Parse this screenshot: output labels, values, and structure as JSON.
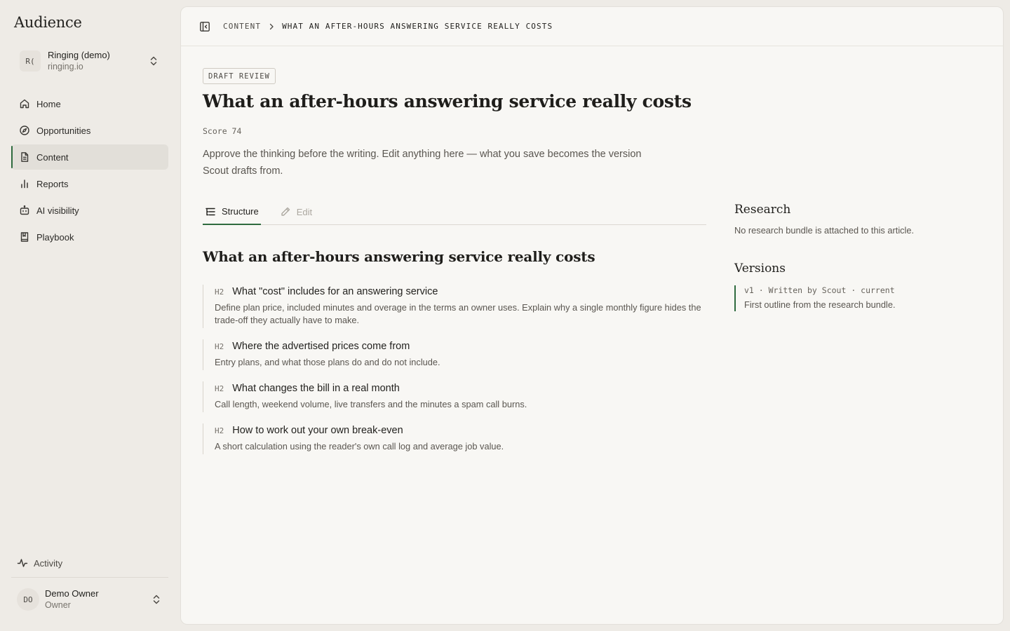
{
  "app": {
    "title": "Audience"
  },
  "workspace": {
    "avatar": "R(",
    "name": "Ringing (demo)",
    "domain": "ringing.io"
  },
  "nav": [
    {
      "label": "Home",
      "icon": "home-icon"
    },
    {
      "label": "Opportunities",
      "icon": "compass-icon"
    },
    {
      "label": "Content",
      "icon": "document-icon",
      "active": true
    },
    {
      "label": "Reports",
      "icon": "bar-chart-icon"
    },
    {
      "label": "AI visibility",
      "icon": "robot-icon"
    },
    {
      "label": "Playbook",
      "icon": "book-icon"
    }
  ],
  "activity": {
    "label": "Activity"
  },
  "user": {
    "initials": "DO",
    "name": "Demo Owner",
    "role": "Owner"
  },
  "breadcrumb": [
    "CONTENT",
    "WHAT AN AFTER-HOURS ANSWERING SERVICE REALLY COSTS"
  ],
  "article": {
    "badge": "DRAFT REVIEW",
    "title": "What an after-hours answering service really costs",
    "score": "Score 74",
    "intro": "Approve the thinking before the writing. Edit anything here — what you save becomes the version Scout drafts from."
  },
  "tabs": [
    {
      "label": "Structure",
      "icon": "list-tree-icon",
      "active": true
    },
    {
      "label": "Edit",
      "icon": "pencil-icon",
      "active": false
    }
  ],
  "outline": {
    "title": "What an after-hours answering service really costs",
    "sections": [
      {
        "level": "H2",
        "heading": "What \"cost\" includes for an answering service",
        "description": "Define plan price, included minutes and overage in the terms an owner uses. Explain why a single monthly figure hides the trade-off they actually have to make."
      },
      {
        "level": "H2",
        "heading": "Where the advertised prices come from",
        "description": "Entry plans, and what those plans do and do not include."
      },
      {
        "level": "H2",
        "heading": "What changes the bill in a real month",
        "description": "Call length, weekend volume, live transfers and the minutes a spam call burns."
      },
      {
        "level": "H2",
        "heading": "How to work out your own break-even",
        "description": "A short calculation using the reader's own call log and average job value."
      }
    ]
  },
  "research": {
    "title": "Research",
    "text": "No research bundle is attached to this article."
  },
  "versions": {
    "title": "Versions",
    "items": [
      {
        "meta": "v1 · Written by Scout · current",
        "note": "First outline from the research bundle."
      }
    ]
  },
  "colors": {
    "accent": "#2f6b3f",
    "sidebar_bg": "#eeebe6",
    "main_bg": "#f8f7f4"
  }
}
